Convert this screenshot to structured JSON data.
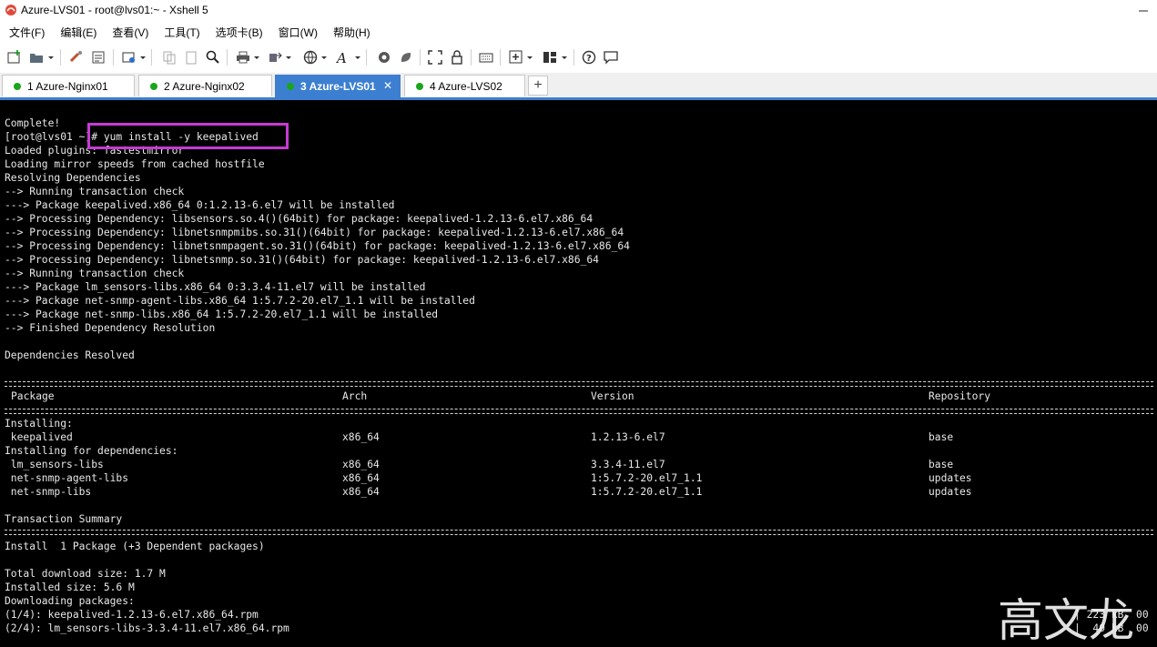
{
  "window": {
    "title": "Azure-LVS01 - root@lvs01:~ - Xshell 5"
  },
  "menu": [
    "文件(F)",
    "编辑(E)",
    "查看(V)",
    "工具(T)",
    "选项卡(B)",
    "窗口(W)",
    "帮助(H)"
  ],
  "tabs": [
    {
      "label": "1 Azure-Nginx01",
      "active": false
    },
    {
      "label": "2 Azure-Nginx02",
      "active": false
    },
    {
      "label": "3 Azure-LVS01",
      "active": true
    },
    {
      "label": "4 Azure-LVS02",
      "active": false
    }
  ],
  "colors": {
    "accent": "#3c7fd0",
    "highlight": "#c63bd3",
    "terminal_bg": "#000000",
    "terminal_fg": "#e8e8e8",
    "status_dot": "#1aa51a"
  },
  "toolbar_icons": [
    "new-session-icon",
    "open-folder-icon",
    "reconnect-icon",
    "properties-icon",
    "new-window-icon",
    "copy-icon",
    "paste-icon",
    "find-icon",
    "print-icon",
    "transfer-icon",
    "globe-icon",
    "font-icon",
    "xftp-icon",
    "script-icon",
    "fullscreen-icon",
    "lock-icon",
    "keyboard-icon",
    "compose-icon",
    "layout-icon",
    "help-icon",
    "chat-icon"
  ],
  "terminal": {
    "pre_lines": [
      "Complete!",
      "[root@lvs01 ~]# yum install -y keepalived",
      "Loaded plugins: fastestmirror",
      "Loading mirror speeds from cached hostfile",
      "Resolving Dependencies",
      "--> Running transaction check",
      "---> Package keepalived.x86_64 0:1.2.13-6.el7 will be installed",
      "--> Processing Dependency: libsensors.so.4()(64bit) for package: keepalived-1.2.13-6.el7.x86_64",
      "--> Processing Dependency: libnetsnmpmibs.so.31()(64bit) for package: keepalived-1.2.13-6.el7.x86_64",
      "--> Processing Dependency: libnetsnmpagent.so.31()(64bit) for package: keepalived-1.2.13-6.el7.x86_64",
      "--> Processing Dependency: libnetsnmp.so.31()(64bit) for package: keepalived-1.2.13-6.el7.x86_64",
      "--> Running transaction check",
      "---> Package lm_sensors-libs.x86_64 0:3.3.4-11.el7 will be installed",
      "---> Package net-snmp-agent-libs.x86_64 1:5.7.2-20.el7_1.1 will be installed",
      "---> Package net-snmp-libs.x86_64 1:5.7.2-20.el7_1.1 will be installed",
      "--> Finished Dependency Resolution",
      "",
      "Dependencies Resolved"
    ],
    "table": {
      "headers": [
        "Package",
        "Arch",
        "Version",
        "Repository"
      ],
      "rows": [
        [
          "Installing:",
          "",
          "",
          ""
        ],
        [
          " keepalived",
          "x86_64",
          "1.2.13-6.el7",
          "base"
        ],
        [
          "Installing for dependencies:",
          "",
          "",
          ""
        ],
        [
          " lm_sensors-libs",
          "x86_64",
          "3.3.4-11.el7",
          "base"
        ],
        [
          " net-snmp-agent-libs",
          "x86_64",
          "1:5.7.2-20.el7_1.1",
          "updates"
        ],
        [
          " net-snmp-libs",
          "x86_64",
          "1:5.7.2-20.el7_1.1",
          "updates"
        ]
      ]
    },
    "summary_title": "Transaction Summary",
    "install_line": "Install  1 Package (+3 Dependent packages)",
    "post_lines": [
      "Total download size: 1.7 M",
      "Installed size: 5.6 M",
      "Downloading packages:",
      "(1/4): keepalived-1.2.13-6.el7.x86_64.rpm",
      "(2/4): lm_sensors-libs-3.3.4-11.el7.x86_64.rpm"
    ],
    "trail": [
      "| 223 kB  00",
      "|  40 kB  00"
    ]
  },
  "watermark": "高文龙"
}
